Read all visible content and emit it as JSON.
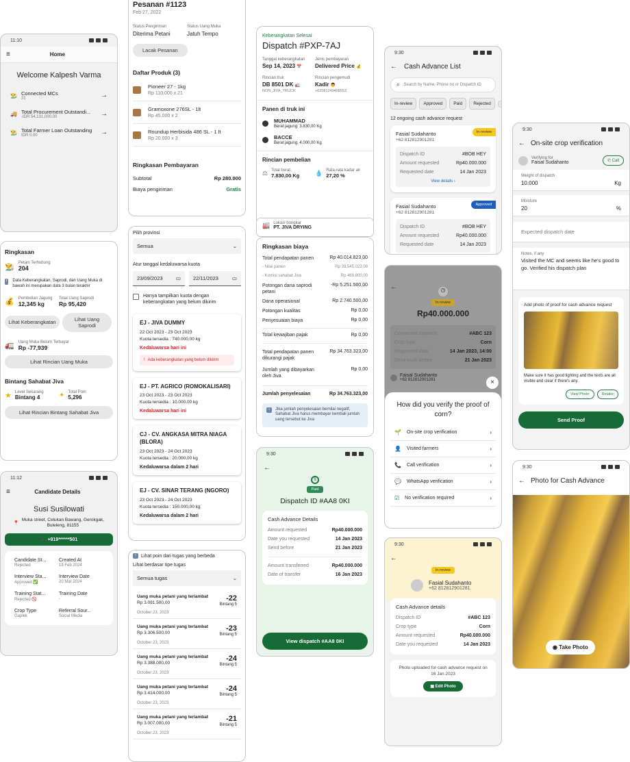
{
  "home": {
    "time": "11:10",
    "title": "Home",
    "welcome": "Welcome Kalpesh Varma",
    "items": [
      {
        "label": "Connected MCs",
        "sub": "21"
      },
      {
        "label": "Total Procurement Outstandi...",
        "sub": "-IDR 54,131,000.00"
      },
      {
        "label": "Total Farmer Loan Outstanding",
        "sub": "IDR 0.00"
      }
    ]
  },
  "ringkasan": {
    "title": "Ringkasan",
    "petani_label": "Petani Terhubung",
    "petani_val": "204",
    "info": "Data Keberangkatan, Saprodi, dan Uang Muka di bawah ini merupakan data 3 bulan terakhir",
    "jagung_label": "Pembelian Jagung",
    "jagung_val": "12,345 kg",
    "saprodi_label": "Total Uang Saprodi",
    "saprodi_val": "Rp 95,420",
    "btn_keberangkatan": "Lihat Keberangkatan",
    "btn_saprodi": "Lihat Uang Saprodi",
    "uangmuka_label": "Uang Muka Belum Terbayar",
    "uangmuka_val": "Rp -77,939",
    "btn_uangmuka": "Lihat Rincian Uang Muka",
    "bintang_title": "Bintang Sahabat Jiva",
    "level_label": "Level Sekarang",
    "level_val": "Bintang 4",
    "poin_label": "Total Poin",
    "poin_val": "5,296",
    "btn_bintang": "Lihat Rincian Bintang Sahabat Jiva"
  },
  "candidate": {
    "time": "11:12",
    "title": "Candidate Details",
    "name": "Susi Susilowati",
    "address": "Muka street, Celukan Bawang, Gerokgak, Buleleng, 81155",
    "phone": "+919******501",
    "fields": [
      {
        "k": "Candidate St...",
        "v": "Rejected"
      },
      {
        "k": "Created At",
        "v": "19 Feb 2024"
      },
      {
        "k": "Interview Sta...",
        "v": "Approved ✅"
      },
      {
        "k": "Interview Date",
        "v": "20 Mar 2024"
      },
      {
        "k": "Training Stat...",
        "v": "Rejected 🚫"
      },
      {
        "k": "Training Date",
        "v": "-"
      },
      {
        "k": "Crop Type",
        "v": "Gaplek"
      },
      {
        "k": "Referral Sour...",
        "v": "Social Media"
      }
    ]
  },
  "pesanan": {
    "title": "Pesanan #1123",
    "date": "Feb 27, 2022",
    "status_label": "Status Pengiriman",
    "status_val": "Diterima Petani",
    "uangmuka_label": "Status Uang Muka",
    "uangmuka_val": "Jatuh Tempo",
    "btn": "Lacak Pesanan",
    "produk_title": "Daftar Produk (3)",
    "produk": [
      {
        "name": "Pioneer 27 - 1kg",
        "price": "Rp 110.000 x 21"
      },
      {
        "name": "Gramoxone 276SL - 1lt",
        "price": "Rp 45.000 x 2"
      },
      {
        "name": "Roundup Herbisida 486 SL - 1 lt",
        "price": "Rp 20.000 x 3"
      }
    ],
    "ringkasan_title": "Ringkasan Pembayaran",
    "subtotal_label": "Subtotal",
    "subtotal_val": "Rp 280.000",
    "biaya_label": "Biaya pengiriman",
    "biaya_val": "Gratis"
  },
  "kuota": {
    "provinsi_label": "Pilih provinsi",
    "provinsi_val": "Semua",
    "tanggal_label": "Atur tanggal kedaluwarsa kuota",
    "date1": "23/09/2023",
    "date2": "22/11/2023",
    "check_label": "Hanya tampilkan kuota dengan keberangkatan yang belum dikirim",
    "items": [
      {
        "name": "EJ - JIVA DUMMY",
        "date": "22 Oct 2023 - 23 Oct 2023",
        "kuota": "Kuota tersedia : 740.000,00 kg",
        "exp": "Kedaluwarsa hari ini",
        "warn": "Ada keberangkatan yang belum dikirim"
      },
      {
        "name": "EJ - PT. AGRICO (ROMOKALISARI)",
        "date": "23 Oct 2023 - 23 Oct 2023",
        "kuota": "Kuota tersedia : 10.000,00 kg",
        "exp": "Kedaluwarsa hari ini"
      },
      {
        "name": "CJ - CV. ANGKASA MITRA NIAGA (BLORA)",
        "date": "23 Oct 2023 - 24 Oct 2023",
        "kuota": "Kuota tersedia : 20.000,00 kg",
        "exp": "Kedaluwarsa dalam 2 hari"
      },
      {
        "name": "EJ - CV. SINAR TERANG (NGORO)",
        "date": "23 Oct 2023 - 24 Oct 2023",
        "kuota": "Kuota tersedia : 150.000,00 kg",
        "exp": "Kedaluwarsa dalam 2 hari"
      }
    ]
  },
  "tugas": {
    "info": "Lihat poin dari tugas yang berbeda",
    "filter_label": "Lihat berdasar tipe tugas",
    "filter_val": "Semua tugas",
    "items": [
      {
        "t": "Uang muka petani yang terlambat",
        "amt": "Rp 3.091.500,00",
        "pts": "-22",
        "lvl": "Bintang 5",
        "date": "October 23, 2023"
      },
      {
        "t": "Uang muka petani yang terlambat",
        "amt": "Rp 3.306.500,00",
        "pts": "-23",
        "lvl": "Bintang 5",
        "date": "October 23, 2023"
      },
      {
        "t": "Uang muka petani yang terlambat",
        "amt": "Rp 3.388.000,00",
        "pts": "-24",
        "lvl": "Bintang 5",
        "date": "October 23, 2023"
      },
      {
        "t": "Uang muka petani yang terlambat",
        "amt": "Rp 3.414.000,00",
        "pts": "-24",
        "lvl": "Bintang 5",
        "date": "October 23, 2023"
      },
      {
        "t": "Uang muka petani yang terlambat",
        "amt": "Rp 3.007.000,00",
        "pts": "-21",
        "lvl": "Bintang 5",
        "date": "October 23, 2023"
      }
    ]
  },
  "dispatch": {
    "status": "Keberangkatan Selesai",
    "title": "Dispatch #PXP-7AJ",
    "tgl_label": "Tanggal keberangkatan",
    "tgl_val": "Sep 14, 2023",
    "jenis_label": "Jenis pembayaran",
    "jenis_val": "Delivered Price",
    "truk_label": "Rincian truk",
    "truk_val": "DB 8501 DK",
    "truk_sub": "NON_JIVA_TRUCK",
    "pengemudi_label": "Rincian pengemudi",
    "pengemudi_val": "Kadir",
    "pengemudi_sub": "+62081249498553",
    "panen_title": "Panen di truk ini",
    "panen": [
      {
        "name": "MUHAMMAD",
        "sub": "Berat jagung: 3.830,00 Kg"
      },
      {
        "name": "BACCE",
        "sub": "Berat jagung: 4.000,00 Kg"
      }
    ],
    "pembelian_title": "Rincian pembelian",
    "berat_label": "Total berat",
    "berat_val": "7.830,00 Kg",
    "kadar_label": "Rata-rata kadar air",
    "kadar_val": "27,20 %",
    "lokasi_label": "Lokasi bongkar",
    "lokasi_val": "PT. JIVA DRYING"
  },
  "biaya": {
    "title": "Ringkasan biaya",
    "rows": [
      {
        "k": "Total pendapatan panen",
        "v": "Rp 40.014.823,00"
      },
      {
        "k": "- Nilai panen",
        "v": "Rp 39.545.023,00",
        "s": 1
      },
      {
        "k": "- Komisi sahabat Jiva",
        "v": "Rp 469.800,00",
        "s": 1
      },
      {
        "k": "Potongan dana saprodi petani",
        "v": "-Rp 5.251.500,00"
      },
      {
        "k": "Dana operasional",
        "v": "Rp 2.740.500,00"
      },
      {
        "k": "Potongan kualitas",
        "v": "Rp 0,00"
      },
      {
        "k": "Penyesuaian biaya",
        "v": "Rp 0,00"
      }
    ],
    "pajak_k": "Total kewajiban pajak",
    "pajak_v": "Rp 0,00",
    "net_k": "Total pendapatan panen dikurangi pajak",
    "net_v": "Rp 34.763.323,00",
    "jiva_k": "Jumlah yang dibayarkan oleh Jiva",
    "jiva_v": "Rp 0,00",
    "total_k": "Jumlah penyelesaian",
    "total_v": "Rp 34.763.323,00",
    "info": "Jika jumlah penyelesaian bernilai negatif, Sahabat Jiva harus membayar kembali jumlah uang tersebut ke Jiva"
  },
  "paid": {
    "time": "9:30",
    "badge": "Paid",
    "title": "Dispatch ID #AA8 0KI",
    "section": "Cash Advance Details",
    "rows": [
      {
        "k": "Amount requested",
        "v": "Rp40.000.000"
      },
      {
        "k": "Date you requested",
        "v": "14 Jan 2023"
      },
      {
        "k": "Send before",
        "v": "21 Jan 2023"
      }
    ],
    "rows2": [
      {
        "k": "Amount transferred",
        "v": "Rp40.000.000"
      },
      {
        "k": "Date of transfer",
        "v": "16 Jan 2023"
      }
    ],
    "btn": "View dispatch #AA8 0KI"
  },
  "calist": {
    "time": "9:30",
    "title": "Cash Advance List",
    "search": "Search by Name, Phone no or Dispatch ID",
    "chips": [
      "In-review",
      "Approved",
      "Paid",
      "Rejected"
    ],
    "count": "12 ongoing cash advance request",
    "cards": [
      {
        "name": "Fasial Sudahanto",
        "phone": "+62 812812901281",
        "badge": "In-review",
        "did": "#BOB HEY",
        "amt": "Rp40.000.000",
        "date": "14 Jan 2023",
        "link": "View details"
      },
      {
        "name": "Fasial Sudahanto",
        "phone": "+62 812812901281",
        "badge": "Approved",
        "did": "#BOB HEY",
        "amt": "Rp40.000.000",
        "date": "14 Jan 2023"
      }
    ],
    "lbl_did": "Dispatch ID",
    "lbl_amt": "Amount requested",
    "lbl_date": "Requested date"
  },
  "verify": {
    "badge": "In-review",
    "amount": "Rp40.000.000",
    "rows": [
      {
        "k": "Connected dispatch",
        "v": "#ABC 123"
      },
      {
        "k": "Crop type",
        "v": "Corn"
      },
      {
        "k": "Requested date",
        "v": "14 Jan 2023, 14:00"
      },
      {
        "k": "Send truck before",
        "v": "21 Jan 2023"
      }
    ],
    "name": "Faisal Sudahanto",
    "phone": "+62 812812901281",
    "question": "How did you verify the proof of corn?",
    "options": [
      "On-site crop verification",
      "Visited farmers",
      "Call verification",
      "WhatsApp verification",
      "No verification required"
    ]
  },
  "review": {
    "time": "9:30",
    "badge": "In-review",
    "name": "Fasial Sudahanto",
    "phone": "+62 812812901281",
    "section": "Cash Advance details",
    "rows": [
      {
        "k": "Dispatch ID",
        "v": "#ABC 123"
      },
      {
        "k": "Crop type",
        "v": "Corn"
      },
      {
        "k": "Amount requested",
        "v": "Rp40.000.000"
      },
      {
        "k": "Date you requested",
        "v": "14 Jan 2023"
      }
    ],
    "upload": "Photo uploaded for cash advance request on 16 Jan 2023",
    "btn": "Edit Photo"
  },
  "onsite": {
    "time": "9:30",
    "title": "On-site crop verification",
    "verifying": "Verifying for",
    "name": "Faisal Sudahanto",
    "call": "Call",
    "weight_label": "Weight of dispatch",
    "weight_val": "10.000",
    "weight_unit": "Kg",
    "moist_label": "Moisture",
    "moist_val": "20",
    "moist_unit": "%",
    "date_ph": "Expected dispatch date",
    "notes_label": "Notes, if any",
    "notes_val": "Visited the MC and seems like he's good to go. Verified his dispatch plan",
    "photo_title": "Add photo of proof for cash advance request",
    "photo_hint": "Make sure it has good lighting and the texts are all visible and clear if there's any.",
    "view": "View Photo",
    "retake": "Retake",
    "send": "Send Proof"
  },
  "camera": {
    "time": "9:30",
    "title": "Photo for Cash Advance",
    "btn": "Take Photo"
  }
}
